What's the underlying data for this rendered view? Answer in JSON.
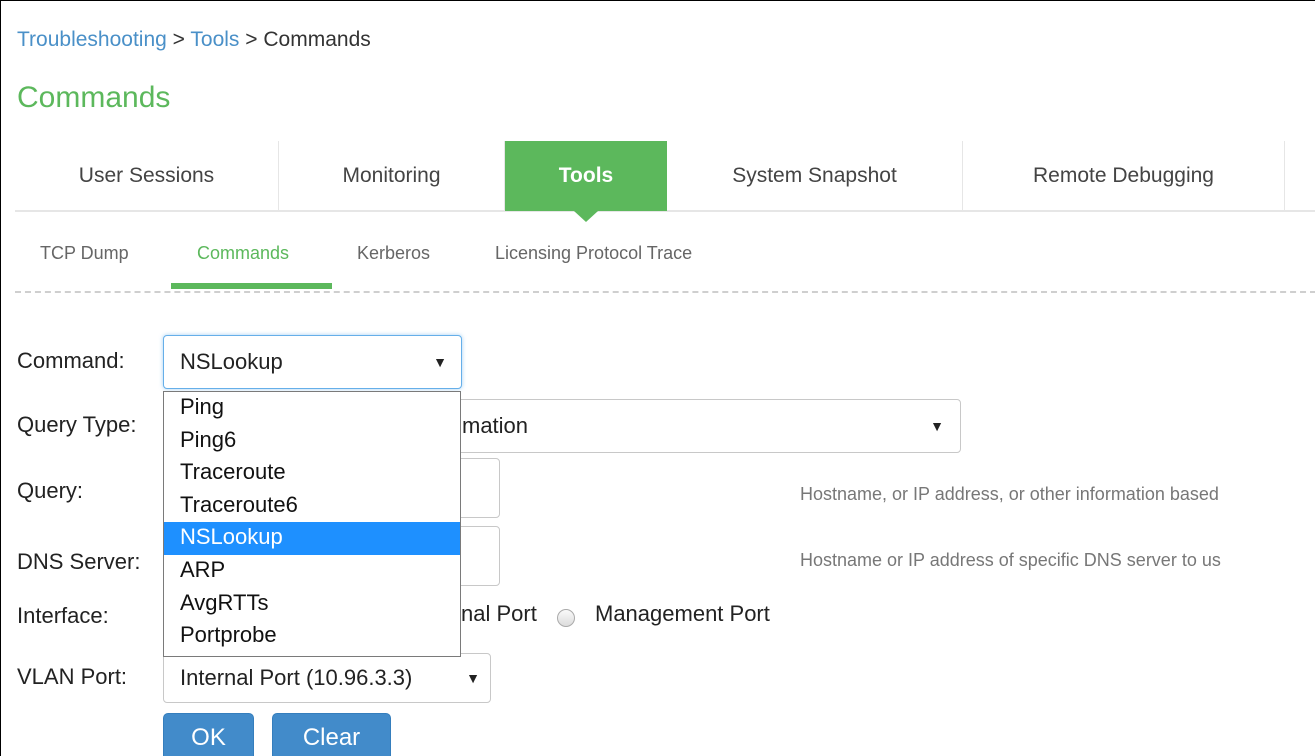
{
  "breadcrumb": {
    "items": [
      "Troubleshooting",
      "Tools",
      "Commands"
    ],
    "separator": ">"
  },
  "page_title": "Commands",
  "main_tabs": [
    {
      "label": "User Sessions",
      "active": false
    },
    {
      "label": "Monitoring",
      "active": false
    },
    {
      "label": "Tools",
      "active": true
    },
    {
      "label": "System Snapshot",
      "active": false
    },
    {
      "label": "Remote Debugging",
      "active": false
    }
  ],
  "sub_tabs": [
    {
      "label": "TCP Dump",
      "active": false
    },
    {
      "label": "Commands",
      "active": true
    },
    {
      "label": "Kerberos",
      "active": false
    },
    {
      "label": "Licensing Protocol Trace",
      "active": false
    }
  ],
  "form": {
    "command": {
      "label": "Command:",
      "value": "NSLookup"
    },
    "query_type": {
      "label": "Query Type:",
      "value_visible": "mation"
    },
    "query": {
      "label": "Query:",
      "help": "Hostname, or IP address, or other information based"
    },
    "dns_server": {
      "label": "DNS Server:",
      "help": "Hostname or IP address of specific DNS server to us"
    },
    "interface": {
      "label": "Interface:",
      "option1_visible": "nal Port",
      "option2": "Management Port"
    },
    "vlan_port": {
      "label": "VLAN Port:",
      "value": "Internal Port (10.96.3.3)"
    },
    "ok_label": "OK",
    "clear_label": "Clear"
  },
  "command_dropdown": {
    "options": [
      "Ping",
      "Ping6",
      "Traceroute",
      "Traceroute6",
      "NSLookup",
      "ARP",
      "AvgRTTs",
      "Portprobe"
    ],
    "selected": "NSLookup"
  },
  "colors": {
    "accent_green": "#5cb85c",
    "link_blue": "#4a90c8",
    "button_blue": "#428bca",
    "selection_blue": "#1e90ff"
  }
}
